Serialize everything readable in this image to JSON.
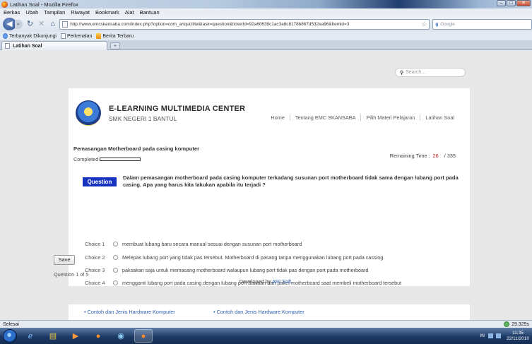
{
  "window": {
    "title": "Latihan Soal - Mozilla Firefox",
    "controls": [
      "–",
      "□",
      "✕"
    ]
  },
  "menu": [
    "Berkas",
    "Ubah",
    "Tampilan",
    "Riwayat",
    "Bookmark",
    "Alat",
    "Bantuan"
  ],
  "nav": {
    "url": "http://www.emcskansaba.com/index.php?option=com_ariquizlite&task=question&ticketId=92a60638c1ac3a8c8178b867d532ea96&Itemid=3",
    "search_engine": "Google",
    "search_placeholder": "Google"
  },
  "bookmarks": [
    "Terbanyak Dikunjungi",
    "Perkenalan",
    "Berita Terbaru"
  ],
  "tab": {
    "label": "Latihan Soal",
    "new_tab": "+"
  },
  "site": {
    "search_placeholder": "Search...",
    "title": "E-LEARNING MULTIMEDIA CENTER",
    "subtitle": "SMK NEGERI 1 BANTUL",
    "nav": [
      "Home",
      "Tentang EMC SKANSABA",
      "Pilih Materi Pelajaran",
      "Latihan Soal"
    ]
  },
  "quiz": {
    "title": "Pemasangan Motherboard pada casing komputer",
    "completed_label": "Completed",
    "progress": 0,
    "remaining_label": "Remaining Time :",
    "remaining_value": "26",
    "remaining_total": "/ 335",
    "question_badge": "Question",
    "question_text": "Dalam pemasangan motherboard pada casing komputer terkadang susunan port motherboard tidak sama dengan lubang port pada casing. Apa yang harus kita lakukan apabila itu terjadi ?",
    "choices": [
      {
        "label": "Choice 1",
        "text": "membuat lubang baru secara manual sesuai dengan susunan port motherboard"
      },
      {
        "label": "Choice 2",
        "text": "Melepas lubang port yang tidak pas tersebut. Motherboard di pasang tanpa menggunakan lubang port pada cassing."
      },
      {
        "label": "Choice 3",
        "text": "paksakan saja untuk memasang motherboard walaupun lubang port tidak pas dengan port pada motherboard"
      },
      {
        "label": "Choice 4",
        "text": "mengganti lubang port pada casing dengan lubang port bawaan dari paket motherboard saat membeli motherboard tersebut"
      }
    ],
    "save_label": "Save",
    "question_count": "Question 1 of 5"
  },
  "footer": {
    "developed_by": "Developed by",
    "developer": "ARI Soft",
    "period": "."
  },
  "related": [
    "• Contoh dan Jenis Hardware Komputer",
    "• Contoh dan Jenis Hardware Komputer"
  ],
  "status": {
    "left": "Selesai",
    "right": "29.329s"
  },
  "taskbar": {
    "clock_time": "11:35",
    "clock_date": "22/11/2010",
    "tray_lang": "IN"
  }
}
